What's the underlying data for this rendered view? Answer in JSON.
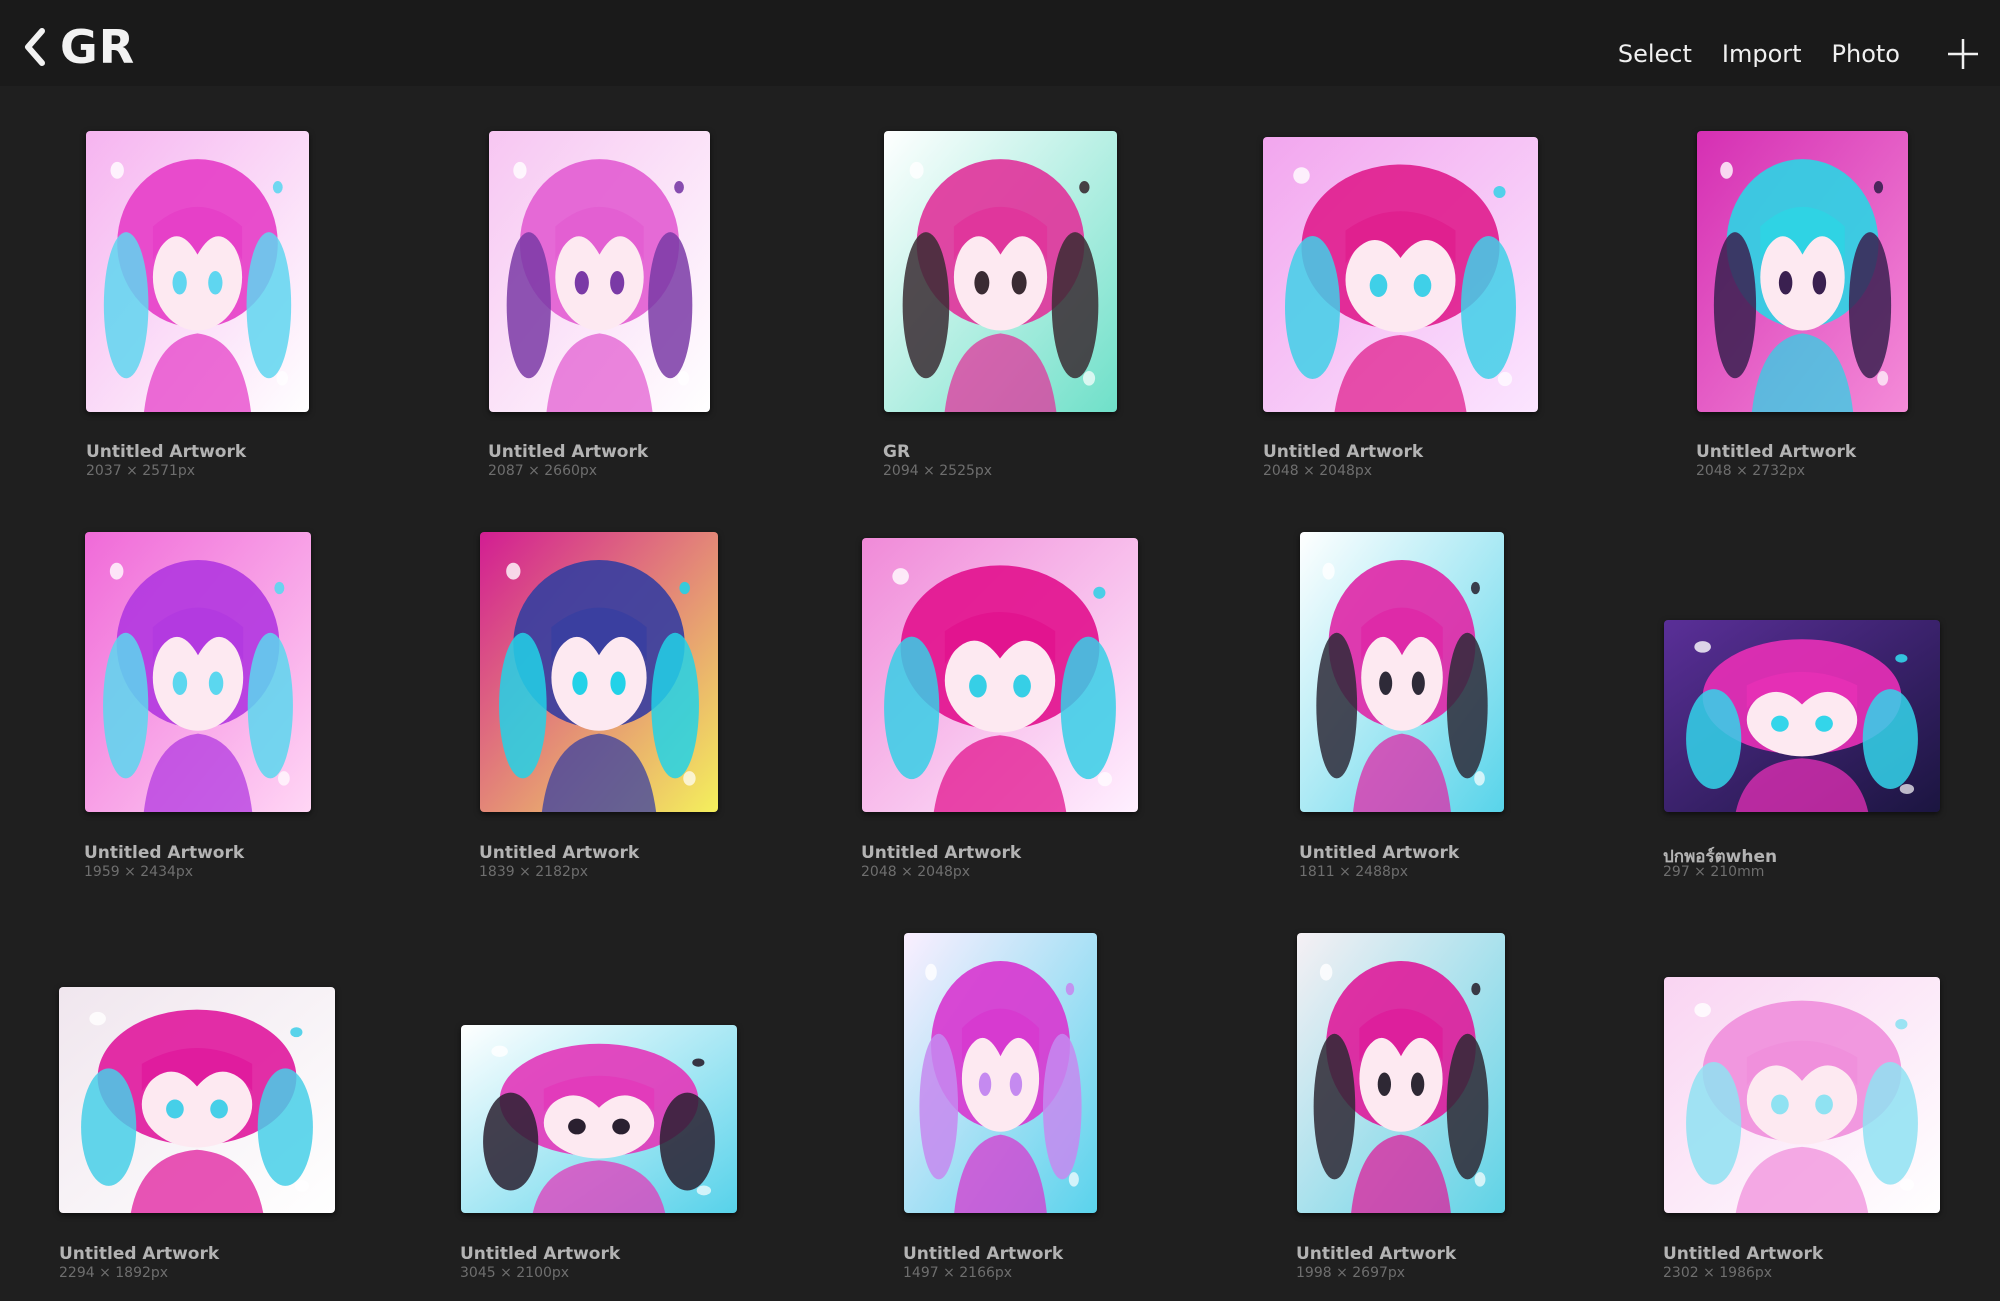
{
  "header": {
    "back_label": "GR",
    "actions": {
      "select": "Select",
      "import": "Import",
      "photo": "Photo"
    }
  },
  "gallery": [
    {
      "name": "Untitled Artwork",
      "dims": "2037 × 2571px",
      "palette": [
        "#f6b4f0",
        "#e640c8",
        "#5fd6f0",
        "#ffffff"
      ]
    },
    {
      "name": "Untitled Artwork",
      "dims": "2087 × 2660px",
      "palette": [
        "#f7c6f2",
        "#e35fd2",
        "#7a3aa6",
        "#ffffff"
      ]
    },
    {
      "name": "GR",
      "dims": "2094 × 2525px",
      "palette": [
        "#ffffff",
        "#e0369c",
        "#3a2b33",
        "#6fe0c9"
      ]
    },
    {
      "name": "Untitled Artwork",
      "dims": "2048 × 2048px",
      "palette": [
        "#f2a6ee",
        "#e0208f",
        "#3fd0e8",
        "#fbe5ff"
      ]
    },
    {
      "name": "Untitled Artwork",
      "dims": "2048 × 2732px",
      "palette": [
        "#d52fb3",
        "#2fd3e4",
        "#3a2050",
        "#f48bd8"
      ]
    },
    {
      "name": "Untitled Artwork",
      "dims": "1959 × 2434px",
      "palette": [
        "#f06ad8",
        "#b33ae0",
        "#5bd7ef",
        "#ffd6f5"
      ]
    },
    {
      "name": "Untitled Artwork",
      "dims": "1839 × 2182px",
      "palette": [
        "#d21d93",
        "#3a3fa0",
        "#22d2e8",
        "#f4f05c"
      ]
    },
    {
      "name": "Untitled Artwork",
      "dims": "2048 × 2048px",
      "palette": [
        "#f08ad8",
        "#e2148f",
        "#36cfe6",
        "#fff0ff"
      ]
    },
    {
      "name": "Untitled Artwork",
      "dims": "1811 × 2488px",
      "palette": [
        "#ffffff",
        "#de2aa8",
        "#2e2a38",
        "#58d4ea"
      ]
    },
    {
      "name": "ปกพอร์ตwhen",
      "dims": "297 × 210mm",
      "palette": [
        "#5a2f98",
        "#e52fb5",
        "#33d5ea",
        "#1b1540"
      ]
    },
    {
      "name": "Untitled Artwork",
      "dims": "2294 × 1892px",
      "palette": [
        "#f0e6ee",
        "#e01c9e",
        "#46cfe8",
        "#ffffff"
      ]
    },
    {
      "name": "Untitled Artwork",
      "dims": "3045 × 2100px",
      "palette": [
        "#ffffff",
        "#e23bbb",
        "#2a2030",
        "#57d2ea"
      ]
    },
    {
      "name": "Untitled Artwork",
      "dims": "1497 × 2166px",
      "palette": [
        "#fbefff",
        "#d73ad0",
        "#c58af0",
        "#5ad3ec"
      ]
    },
    {
      "name": "Untitled Artwork",
      "dims": "1998 × 2697px",
      "palette": [
        "#f6f0f4",
        "#dd1f9c",
        "#2e2834",
        "#5fd3e6"
      ]
    },
    {
      "name": "Untitled Artwork",
      "dims": "2302 × 1986px",
      "palette": [
        "#f9d4f2",
        "#f090dc",
        "#8fe2f2",
        "#ffffff"
      ]
    }
  ]
}
